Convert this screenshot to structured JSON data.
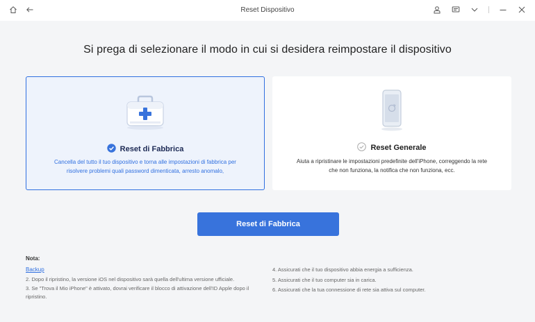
{
  "titlebar": {
    "title": "Reset Dispositivo",
    "left_icons": [
      "home-icon",
      "back-arrow-icon"
    ],
    "right_icons": [
      "user-icon",
      "chat-icon",
      "chevron-down-icon",
      "minimize-icon",
      "close-icon"
    ]
  },
  "heading": "Si prega di selezionare il modo in cui si desidera reimpostare il dispositivo",
  "cards": [
    {
      "title": "Reset di Fabbrica",
      "description": "Cancella del tutto il tuo dispositivo e torna alle impostazioni di fabbrica per risolvere problemi quali password dimenticata, arresto anomalo,",
      "selected": true,
      "icon": "first-aid-kit-icon"
    },
    {
      "title": "Reset Generale",
      "description": "Aiuta a ripristinare le impostazioni predefinite dell'iPhone, correggendo la rete che non funziona, la notifica che non funziona, ecc.",
      "selected": false,
      "icon": "phone-refresh-icon"
    }
  ],
  "primary_button": "Reset di Fabbrica",
  "notes": {
    "label": "Nota:",
    "backup_link": "Backup",
    "left_items": [
      "2. Dopo il ripristino, la versione iOS nel dispositivo sarà quella dell'ultima versione ufficiale.",
      "3. Se \"Trova il Mio iPhone\" è attivato, dovrai verificare il blocco di attivazione dell'ID Apple dopo il ripristino."
    ],
    "right_items": [
      "4. Assicurati che il tuo dispositivo abbia energia a sufficienza.",
      "5. Assicurati che il tuo computer sia in carica.",
      "6. Assicurati che la tua connessione di rete sia attiva sul computer."
    ]
  },
  "colors": {
    "accent": "#3873dc",
    "selected_border": "#2f6fe0",
    "selected_bg": "#eef3fc",
    "background": "#f4f5f7"
  }
}
